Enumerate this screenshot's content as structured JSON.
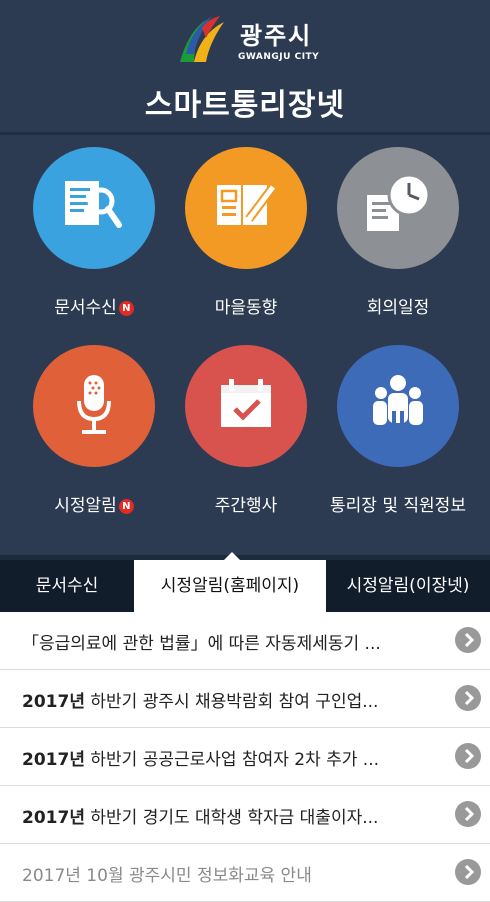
{
  "header": {
    "city_name": "광주시",
    "city_en": "GWANGJU CITY",
    "app_title": "스마트통리장넷"
  },
  "menu": {
    "items": [
      {
        "label": "문서수신",
        "icon": "document-search-icon",
        "color": "#3aa2de",
        "badge": "N"
      },
      {
        "label": "마을동향",
        "icon": "notebook-pencil-icon",
        "color": "#f29a23",
        "badge": ""
      },
      {
        "label": "회의일정",
        "icon": "document-clock-icon",
        "color": "#8d9095",
        "badge": ""
      },
      {
        "label": "시정알림",
        "icon": "microphone-icon",
        "color": "#e0603a",
        "badge": "N"
      },
      {
        "label": "주간행사",
        "icon": "calendar-check-icon",
        "color": "#d9534e",
        "badge": ""
      },
      {
        "label": "통리장 및 직원정보",
        "icon": "people-group-icon",
        "color": "#3d6bb8",
        "badge": ""
      }
    ]
  },
  "tabs": [
    {
      "label": "문서수신",
      "active": false
    },
    {
      "label": "시정알림(홈페이지)",
      "active": true
    },
    {
      "label": "시정알림(이장넷)",
      "active": false
    }
  ],
  "list": [
    {
      "text": "「응급의료에 관한 법률」에 따른 자동제세동기 ...",
      "bold_prefix": "",
      "muted": false
    },
    {
      "text": " 하반기 광주시 채용박람회 참여 구인업...",
      "bold_prefix": "2017년",
      "muted": false
    },
    {
      "text": " 하반기 공공근로사업 참여자 2차 추가 ...",
      "bold_prefix": "2017년",
      "muted": false
    },
    {
      "text": " 하반기 경기도 대학생 학자금 대출이자...",
      "bold_prefix": "2017년",
      "muted": false
    },
    {
      "text": "2017년 10월 광주시민 정보화교육 안내",
      "bold_prefix": "",
      "muted": true
    }
  ]
}
